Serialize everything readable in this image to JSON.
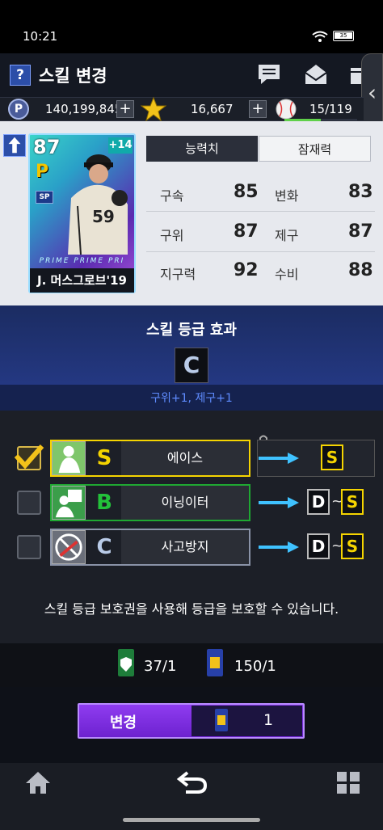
{
  "status_bar": {
    "time": "10:21",
    "battery": "35"
  },
  "header": {
    "help_label": "?",
    "title": "스킬 변경"
  },
  "currency": {
    "points": "140,199,845",
    "stars": "16,667",
    "stamina": "15/119",
    "stamina_fraction": 0.5
  },
  "card": {
    "overall": "87",
    "plus": "+14",
    "type_badge": "SP",
    "series": "PRIME    PRIME    PRI",
    "name": "J. 머스그로브'19"
  },
  "tabs": {
    "ability": "능력치",
    "potential": "잠재력"
  },
  "stats": [
    {
      "label": "구속",
      "value": "85",
      "label2": "변화",
      "value2": "83"
    },
    {
      "label": "구위",
      "value": "87",
      "label2": "제구",
      "value2": "87"
    },
    {
      "label": "지구력",
      "value": "92",
      "label2": "수비",
      "value2": "88"
    }
  ],
  "effect": {
    "title": "스킬 등급 효과",
    "grade": "C",
    "description": "구위+1, 제구+1"
  },
  "skills": [
    {
      "name": "에이스",
      "grade": "S",
      "checked": true,
      "target_from": "",
      "target_to": "S",
      "locked": true,
      "color": "#f5d400"
    },
    {
      "name": "이닝이터",
      "grade": "B",
      "checked": false,
      "target_from": "D",
      "target_to": "S",
      "locked": false,
      "color": "#23c23a"
    },
    {
      "name": "사고방지",
      "grade": "C",
      "checked": false,
      "target_from": "D",
      "target_to": "S",
      "locked": false,
      "color": "#b9cbe8"
    }
  ],
  "notice": "스킬 등급 보호권을 사용해 등급을 보호할 수 있습니다.",
  "tickets": {
    "protect": "37/1",
    "change": "150/1"
  },
  "change_button": {
    "label": "변경",
    "cost": "1"
  }
}
